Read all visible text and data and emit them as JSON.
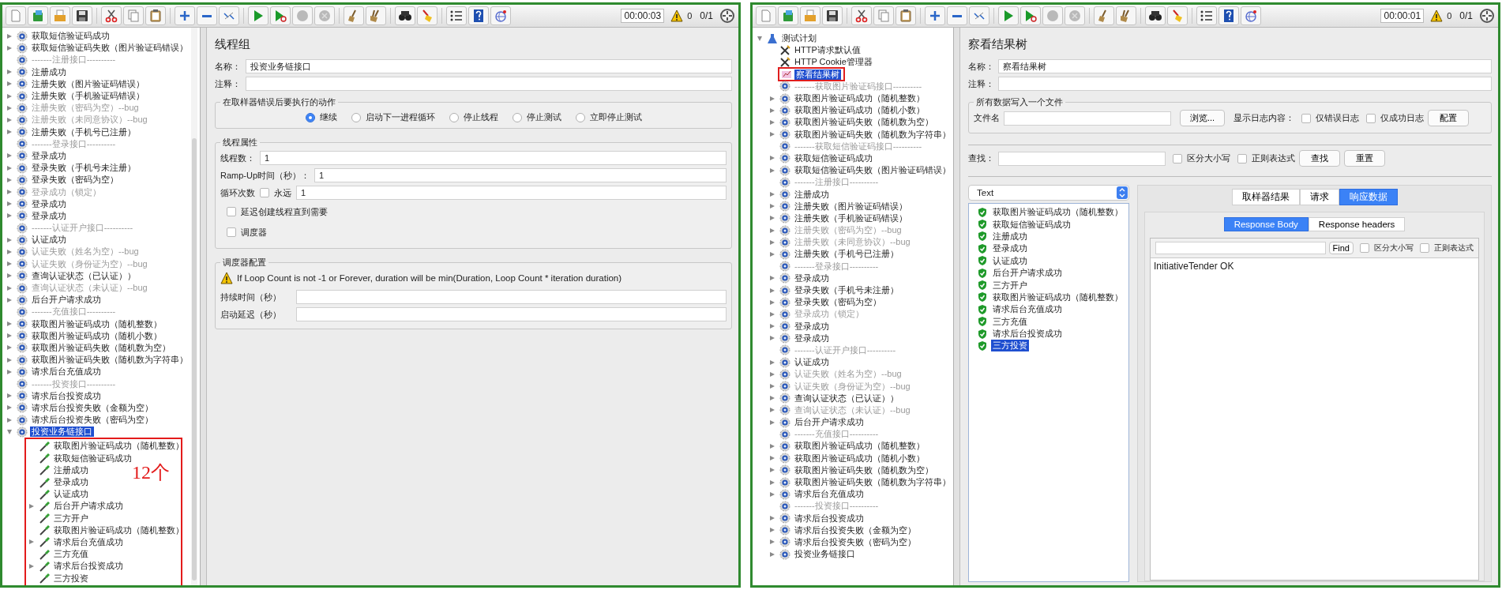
{
  "windows": [
    {
      "toolbar": {
        "button_groups": [
          [
            {
              "kind": "new",
              "disabled": false
            },
            {
              "kind": "templates",
              "disabled": false
            },
            {
              "kind": "open",
              "disabled": false
            },
            {
              "kind": "save",
              "disabled": false
            }
          ],
          [
            {
              "kind": "cut",
              "disabled": false
            },
            {
              "kind": "copy",
              "disabled": false
            },
            {
              "kind": "paste",
              "disabled": false
            }
          ],
          [
            {
              "kind": "expand",
              "disabled": false
            },
            {
              "kind": "collapse",
              "disabled": false
            },
            {
              "kind": "toggle",
              "disabled": false
            }
          ],
          [
            {
              "kind": "start",
              "disabled": false
            },
            {
              "kind": "start_no_pause",
              "disabled": false
            },
            {
              "kind": "stop",
              "disabled": true
            },
            {
              "kind": "shutdown",
              "disabled": true
            }
          ],
          [
            {
              "kind": "clear",
              "disabled": false
            },
            {
              "kind": "clear_all",
              "disabled": false
            }
          ],
          [
            {
              "kind": "search",
              "disabled": false
            },
            {
              "kind": "reset_search",
              "disabled": false
            }
          ],
          [
            {
              "kind": "function",
              "disabled": false
            },
            {
              "kind": "help",
              "disabled": false
            },
            {
              "kind": "remote",
              "disabled": false
            }
          ]
        ],
        "timer": "00:00:03",
        "error_count": "0",
        "threads": "0/1"
      },
      "tree": [
        {
          "label": "获取短信验证码成功",
          "kind": "controller",
          "expandable": true,
          "disabled": false,
          "selected": false
        },
        {
          "label": "获取短信验证码失败（图片验证码错误）",
          "kind": "controller",
          "expandable": true,
          "disabled": false,
          "selected": false
        },
        {
          "label": "-------注册接口----------",
          "kind": "controller",
          "expandable": false,
          "disabled": true,
          "selected": false
        },
        {
          "label": "注册成功",
          "kind": "controller",
          "expandable": true,
          "disabled": false,
          "selected": false
        },
        {
          "label": "注册失败（图片验证码错误）",
          "kind": "controller",
          "expandable": true,
          "disabled": false,
          "selected": false
        },
        {
          "label": "注册失败（手机验证码错误）",
          "kind": "controller",
          "expandable": true,
          "disabled": false,
          "selected": false
        },
        {
          "label": "注册失败（密码为空）--bug",
          "kind": "controller",
          "expandable": true,
          "disabled": true,
          "selected": false
        },
        {
          "label": "注册失败（未同意协议）--bug",
          "kind": "controller",
          "expandable": true,
          "disabled": true,
          "selected": false
        },
        {
          "label": "注册失败（手机号已注册）",
          "kind": "controller",
          "expandable": true,
          "disabled": false,
          "selected": false
        },
        {
          "label": "-------登录接口----------",
          "kind": "controller",
          "expandable": false,
          "disabled": true,
          "selected": false
        },
        {
          "label": "登录成功",
          "kind": "controller",
          "expandable": true,
          "disabled": false,
          "selected": false
        },
        {
          "label": "登录失败（手机号未注册）",
          "kind": "controller",
          "expandable": true,
          "disabled": false,
          "selected": false
        },
        {
          "label": "登录失败（密码为空）",
          "kind": "controller",
          "expandable": true,
          "disabled": false,
          "selected": false
        },
        {
          "label": "登录成功（锁定）",
          "kind": "controller",
          "expandable": true,
          "disabled": true,
          "selected": false
        },
        {
          "label": "登录成功",
          "kind": "controller",
          "expandable": true,
          "disabled": false,
          "selected": false
        },
        {
          "label": "登录成功",
          "kind": "controller",
          "expandable": true,
          "disabled": false,
          "selected": false
        },
        {
          "label": "-------认证开户接口----------",
          "kind": "controller",
          "expandable": false,
          "disabled": true,
          "selected": false
        },
        {
          "label": "认证成功",
          "kind": "controller",
          "expandable": true,
          "disabled": false,
          "selected": false
        },
        {
          "label": "认证失败（姓名为空）--bug",
          "kind": "controller",
          "expandable": true,
          "disabled": true,
          "selected": false
        },
        {
          "label": "认证失败（身份证为空）--bug",
          "kind": "controller",
          "expandable": true,
          "disabled": true,
          "selected": false
        },
        {
          "label": "查询认证状态（已认证））",
          "kind": "controller",
          "expandable": true,
          "disabled": false,
          "selected": false
        },
        {
          "label": "查询认证状态（未认证）--bug",
          "kind": "controller",
          "expandable": true,
          "disabled": true,
          "selected": false
        },
        {
          "label": "后台开户请求成功",
          "kind": "controller",
          "expandable": true,
          "disabled": false,
          "selected": false
        },
        {
          "label": "-------充值接口----------",
          "kind": "controller",
          "expandable": false,
          "disabled": true,
          "selected": false
        },
        {
          "label": "获取图片验证码成功（随机整数）",
          "kind": "controller",
          "expandable": true,
          "disabled": false,
          "selected": false
        },
        {
          "label": "获取图片验证码成功（随机小数）",
          "kind": "controller",
          "expandable": true,
          "disabled": false,
          "selected": false
        },
        {
          "label": "获取图片验证码失败（随机数为空）",
          "kind": "controller",
          "expandable": true,
          "disabled": false,
          "selected": false
        },
        {
          "label": "获取图片验证码失败（随机数为字符串）",
          "kind": "controller",
          "expandable": true,
          "disabled": false,
          "selected": false
        },
        {
          "label": "请求后台充值成功",
          "kind": "controller",
          "expandable": true,
          "disabled": false,
          "selected": false
        },
        {
          "label": "-------投资接口----------",
          "kind": "controller",
          "expandable": false,
          "disabled": true,
          "selected": false
        },
        {
          "label": "请求后台投资成功",
          "kind": "controller",
          "expandable": true,
          "disabled": false,
          "selected": false
        },
        {
          "label": "请求后台投资失败（金额为空）",
          "kind": "controller",
          "expandable": true,
          "disabled": false,
          "selected": false
        },
        {
          "label": "请求后台投资失败（密码为空）",
          "kind": "controller",
          "expandable": true,
          "disabled": false,
          "selected": false
        },
        {
          "label": "投资业务链接口",
          "kind": "controller",
          "expandable": true,
          "expanded": true,
          "disabled": false,
          "selected": true,
          "children_note": "12个",
          "children": [
            {
              "label": "获取图片验证码成功（随机整数）",
              "kind": "request",
              "expandable": false,
              "disabled": false,
              "selected": false
            },
            {
              "label": "获取短信验证码成功",
              "kind": "request",
              "expandable": false,
              "disabled": false,
              "selected": false
            },
            {
              "label": "注册成功",
              "kind": "request",
              "expandable": false,
              "disabled": false,
              "selected": false
            },
            {
              "label": "登录成功",
              "kind": "request",
              "expandable": false,
              "disabled": false,
              "selected": false
            },
            {
              "label": "认证成功",
              "kind": "request",
              "expandable": false,
              "disabled": false,
              "selected": false
            },
            {
              "label": "后台开户请求成功",
              "kind": "request",
              "expandable": true,
              "disabled": false,
              "selected": false
            },
            {
              "label": "三方开户",
              "kind": "request",
              "expandable": false,
              "disabled": false,
              "selected": false
            },
            {
              "label": "获取图片验证码成功（随机整数）",
              "kind": "request",
              "expandable": false,
              "disabled": false,
              "selected": false
            },
            {
              "label": "请求后台充值成功",
              "kind": "request",
              "expandable": true,
              "disabled": false,
              "selected": false
            },
            {
              "label": "三方充值",
              "kind": "request",
              "expandable": false,
              "disabled": false,
              "selected": false
            },
            {
              "label": "请求后台投资成功",
              "kind": "request",
              "expandable": true,
              "disabled": false,
              "selected": false
            },
            {
              "label": "三方投资",
              "kind": "request",
              "expandable": false,
              "disabled": false,
              "selected": false
            }
          ]
        }
      ],
      "editor": {
        "kind": "thread_group",
        "title": "线程组",
        "name_label": "名称：",
        "name_value": "投资业务链接口",
        "comment_label": "注释：",
        "error_action": {
          "legend": "在取样器错误后要执行的动作",
          "options": [
            {
              "label": "继续",
              "selected": true
            },
            {
              "label": "启动下一进程循环",
              "selected": false
            },
            {
              "label": "停止线程",
              "selected": false
            },
            {
              "label": "停止测试",
              "selected": false
            },
            {
              "label": "立即停止测试",
              "selected": false
            }
          ]
        },
        "properties": {
          "legend": "线程属性",
          "threads_label": "线程数：",
          "threads_value": "1",
          "rampup_label": "Ramp-Up时间（秒）：",
          "rampup_value": "1",
          "loop_label": "循环次数",
          "forever": {
            "label": "永远",
            "checked": false
          },
          "loop_value": "1",
          "options": [
            {
              "label": "延迟创建线程直到需要",
              "checked": false
            },
            {
              "label": "调度器",
              "checked": false
            }
          ]
        },
        "scheduler": {
          "legend": "调度器配置",
          "warning": "If Loop Count is not -1 or Forever, duration will be min(Duration, Loop Count * iteration duration)",
          "fields": [
            {
              "label": "持续时间（秒）"
            },
            {
              "label": "启动延迟（秒）"
            }
          ]
        }
      }
    },
    {
      "toolbar": {
        "button_groups": [
          [
            {
              "kind": "new",
              "disabled": false
            },
            {
              "kind": "templates",
              "disabled": false
            },
            {
              "kind": "open",
              "disabled": false
            },
            {
              "kind": "save",
              "disabled": false
            }
          ],
          [
            {
              "kind": "cut",
              "disabled": false
            },
            {
              "kind": "copy",
              "disabled": false
            },
            {
              "kind": "paste",
              "disabled": false
            }
          ],
          [
            {
              "kind": "expand",
              "disabled": false
            },
            {
              "kind": "collapse",
              "disabled": false
            },
            {
              "kind": "toggle",
              "disabled": false
            }
          ],
          [
            {
              "kind": "start",
              "disabled": false
            },
            {
              "kind": "start_no_pause",
              "disabled": false
            },
            {
              "kind": "stop",
              "disabled": true
            },
            {
              "kind": "shutdown",
              "disabled": true
            }
          ],
          [
            {
              "kind": "clear",
              "disabled": false
            },
            {
              "kind": "clear_all",
              "disabled": false
            }
          ],
          [
            {
              "kind": "search",
              "disabled": false
            },
            {
              "kind": "reset_search",
              "disabled": false
            }
          ],
          [
            {
              "kind": "function",
              "disabled": false
            },
            {
              "kind": "help",
              "disabled": false
            },
            {
              "kind": "remote",
              "disabled": false
            }
          ]
        ],
        "timer": "00:00:01",
        "error_count": "0",
        "threads": "0/1"
      },
      "tree": [
        {
          "label": "测试计划",
          "kind": "plan",
          "expandable": true,
          "expanded": true,
          "disabled": false,
          "selected": false,
          "children": [
            {
              "label": "HTTP请求默认值",
              "kind": "config",
              "expandable": false,
              "disabled": false,
              "selected": false,
              "boxed": false
            },
            {
              "label": "HTTP Cookie管理器",
              "kind": "config",
              "expandable": false,
              "disabled": false,
              "selected": false,
              "boxed": false
            },
            {
              "label": "察看结果树",
              "kind": "listener",
              "expandable": false,
              "disabled": false,
              "selected": true,
              "boxed": true
            },
            {
              "label": "-------获取图片验证码接口----------",
              "kind": "controller",
              "expandable": false,
              "disabled": true,
              "selected": false,
              "boxed": false
            },
            {
              "label": "获取图片验证码成功（随机整数）",
              "kind": "controller",
              "expandable": true,
              "disabled": false,
              "selected": false,
              "boxed": false
            },
            {
              "label": "获取图片验证码成功（随机小数）",
              "kind": "controller",
              "expandable": true,
              "disabled": false,
              "selected": false,
              "boxed": false
            },
            {
              "label": "获取图片验证码失败（随机数为空）",
              "kind": "controller",
              "expandable": true,
              "disabled": false,
              "selected": false,
              "boxed": false
            },
            {
              "label": "获取图片验证码失败（随机数为字符串）",
              "kind": "controller",
              "expandable": true,
              "disabled": false,
              "selected": false,
              "boxed": false
            },
            {
              "label": "-------获取短信验证码接口----------",
              "kind": "controller",
              "expandable": false,
              "disabled": true,
              "selected": false,
              "boxed": false
            },
            {
              "label": "获取短信验证码成功",
              "kind": "controller",
              "expandable": true,
              "disabled": false,
              "selected": false,
              "boxed": false
            },
            {
              "label": "获取短信验证码失败（图片验证码错误）",
              "kind": "controller",
              "expandable": true,
              "disabled": false,
              "selected": false,
              "boxed": false
            },
            {
              "label": "-------注册接口----------",
              "kind": "controller",
              "expandable": false,
              "disabled": true,
              "selected": false,
              "boxed": false
            },
            {
              "label": "注册成功",
              "kind": "controller",
              "expandable": true,
              "disabled": false,
              "selected": false,
              "boxed": false
            },
            {
              "label": "注册失败（图片验证码错误）",
              "kind": "controller",
              "expandable": true,
              "disabled": false,
              "selected": false,
              "boxed": false
            },
            {
              "label": "注册失败（手机验证码错误）",
              "kind": "controller",
              "expandable": true,
              "disabled": false,
              "selected": false,
              "boxed": false
            },
            {
              "label": "注册失败（密码为空）--bug",
              "kind": "controller",
              "expandable": true,
              "disabled": true,
              "selected": false,
              "boxed": false
            },
            {
              "label": "注册失败（未同意协议）--bug",
              "kind": "controller",
              "expandable": true,
              "disabled": true,
              "selected": false,
              "boxed": false
            },
            {
              "label": "注册失败（手机号已注册）",
              "kind": "controller",
              "expandable": true,
              "disabled": false,
              "selected": false,
              "boxed": false
            },
            {
              "label": "-------登录接口----------",
              "kind": "controller",
              "expandable": false,
              "disabled": true,
              "selected": false,
              "boxed": false
            },
            {
              "label": "登录成功",
              "kind": "controller",
              "expandable": true,
              "disabled": false,
              "selected": false,
              "boxed": false
            },
            {
              "label": "登录失败（手机号未注册）",
              "kind": "controller",
              "expandable": true,
              "disabled": false,
              "selected": false,
              "boxed": false
            },
            {
              "label": "登录失败（密码为空）",
              "kind": "controller",
              "expandable": true,
              "disabled": false,
              "selected": false,
              "boxed": false
            },
            {
              "label": "登录成功（锁定）",
              "kind": "controller",
              "expandable": true,
              "disabled": true,
              "selected": false,
              "boxed": false
            },
            {
              "label": "登录成功",
              "kind": "controller",
              "expandable": true,
              "disabled": false,
              "selected": false,
              "boxed": false
            },
            {
              "label": "登录成功",
              "kind": "controller",
              "expandable": true,
              "disabled": false,
              "selected": false,
              "boxed": false
            },
            {
              "label": "-------认证开户接口----------",
              "kind": "controller",
              "expandable": false,
              "disabled": true,
              "selected": false,
              "boxed": false
            },
            {
              "label": "认证成功",
              "kind": "controller",
              "expandable": true,
              "disabled": false,
              "selected": false,
              "boxed": false
            },
            {
              "label": "认证失败（姓名为空）--bug",
              "kind": "controller",
              "expandable": true,
              "disabled": true,
              "selected": false,
              "boxed": false
            },
            {
              "label": "认证失败（身份证为空）--bug",
              "kind": "controller",
              "expandable": true,
              "disabled": true,
              "selected": false,
              "boxed": false
            },
            {
              "label": "查询认证状态（已认证））",
              "kind": "controller",
              "expandable": true,
              "disabled": false,
              "selected": false,
              "boxed": false
            },
            {
              "label": "查询认证状态（未认证）--bug",
              "kind": "controller",
              "expandable": true,
              "disabled": true,
              "selected": false,
              "boxed": false
            },
            {
              "label": "后台开户请求成功",
              "kind": "controller",
              "expandable": true,
              "disabled": false,
              "selected": false,
              "boxed": false
            },
            {
              "label": "-------充值接口----------",
              "kind": "controller",
              "expandable": false,
              "disabled": true,
              "selected": false,
              "boxed": false
            },
            {
              "label": "获取图片验证码成功（随机整数）",
              "kind": "controller",
              "expandable": true,
              "disabled": false,
              "selected": false,
              "boxed": false
            },
            {
              "label": "获取图片验证码成功（随机小数）",
              "kind": "controller",
              "expandable": true,
              "disabled": false,
              "selected": false,
              "boxed": false
            },
            {
              "label": "获取图片验证码失败（随机数为空）",
              "kind": "controller",
              "expandable": true,
              "disabled": false,
              "selected": false,
              "boxed": false
            },
            {
              "label": "获取图片验证码失败（随机数为字符串）",
              "kind": "controller",
              "expandable": true,
              "disabled": false,
              "selected": false,
              "boxed": false
            },
            {
              "label": "请求后台充值成功",
              "kind": "controller",
              "expandable": true,
              "disabled": false,
              "selected": false,
              "boxed": false
            },
            {
              "label": "-------投资接口----------",
              "kind": "controller",
              "expandable": false,
              "disabled": true,
              "selected": false,
              "boxed": false
            },
            {
              "label": "请求后台投资成功",
              "kind": "controller",
              "expandable": true,
              "disabled": false,
              "selected": false,
              "boxed": false
            },
            {
              "label": "请求后台投资失败（金额为空）",
              "kind": "controller",
              "expandable": true,
              "disabled": false,
              "selected": false,
              "boxed": false
            },
            {
              "label": "请求后台投资失败（密码为空）",
              "kind": "controller",
              "expandable": true,
              "disabled": false,
              "selected": false,
              "boxed": false
            },
            {
              "label": "投资业务链接口",
              "kind": "controller",
              "expandable": true,
              "disabled": false,
              "selected": false,
              "boxed": false
            }
          ]
        }
      ],
      "editor": {
        "kind": "results_tree",
        "title": "察看结果树",
        "name_label": "名称：",
        "name_value": "察看结果树",
        "comment_label": "注释：",
        "file": {
          "legend": "所有数据写入一个文件",
          "filename_label": "文件名",
          "browse_button": "浏览...",
          "log_label": "显示日志内容：",
          "log_options": [
            {
              "label": "仅错误日志",
              "checked": false
            },
            {
              "label": "仅成功日志",
              "checked": false
            }
          ],
          "config_button": "配置"
        },
        "search": {
          "label": "查找：",
          "options": [
            {
              "label": "区分大小写",
              "checked": false
            },
            {
              "label": "正则表达式",
              "checked": false
            }
          ],
          "find_button": "查找",
          "reset_button": "重置"
        },
        "renderer": "Text",
        "results": [
          {
            "label": "获取图片验证码成功（随机整数）",
            "selected": false
          },
          {
            "label": "获取短信验证码成功",
            "selected": false
          },
          {
            "label": "注册成功",
            "selected": false
          },
          {
            "label": "登录成功",
            "selected": false
          },
          {
            "label": "认证成功",
            "selected": false
          },
          {
            "label": "后台开户请求成功",
            "selected": false
          },
          {
            "label": "三方开户",
            "selected": false
          },
          {
            "label": "获取图片验证码成功（随机整数）",
            "selected": false
          },
          {
            "label": "请求后台充值成功",
            "selected": false
          },
          {
            "label": "三方充值",
            "selected": false
          },
          {
            "label": "请求后台投资成功",
            "selected": false
          },
          {
            "label": "三方投资",
            "selected": true
          }
        ],
        "tabs": [
          {
            "label": "取样器结果",
            "selected": false
          },
          {
            "label": "请求",
            "selected": false
          },
          {
            "label": "响应数据",
            "selected": true
          }
        ],
        "subtabs": [
          {
            "label": "Response Body",
            "selected": true
          },
          {
            "label": "Response headers",
            "selected": false
          }
        ],
        "body_search": {
          "button": "Find",
          "options": [
            {
              "label": "区分大小写",
              "checked": false
            },
            {
              "label": "正则表达式",
              "checked": false
            }
          ]
        },
        "response_text": "InitiativeTender OK"
      }
    }
  ]
}
